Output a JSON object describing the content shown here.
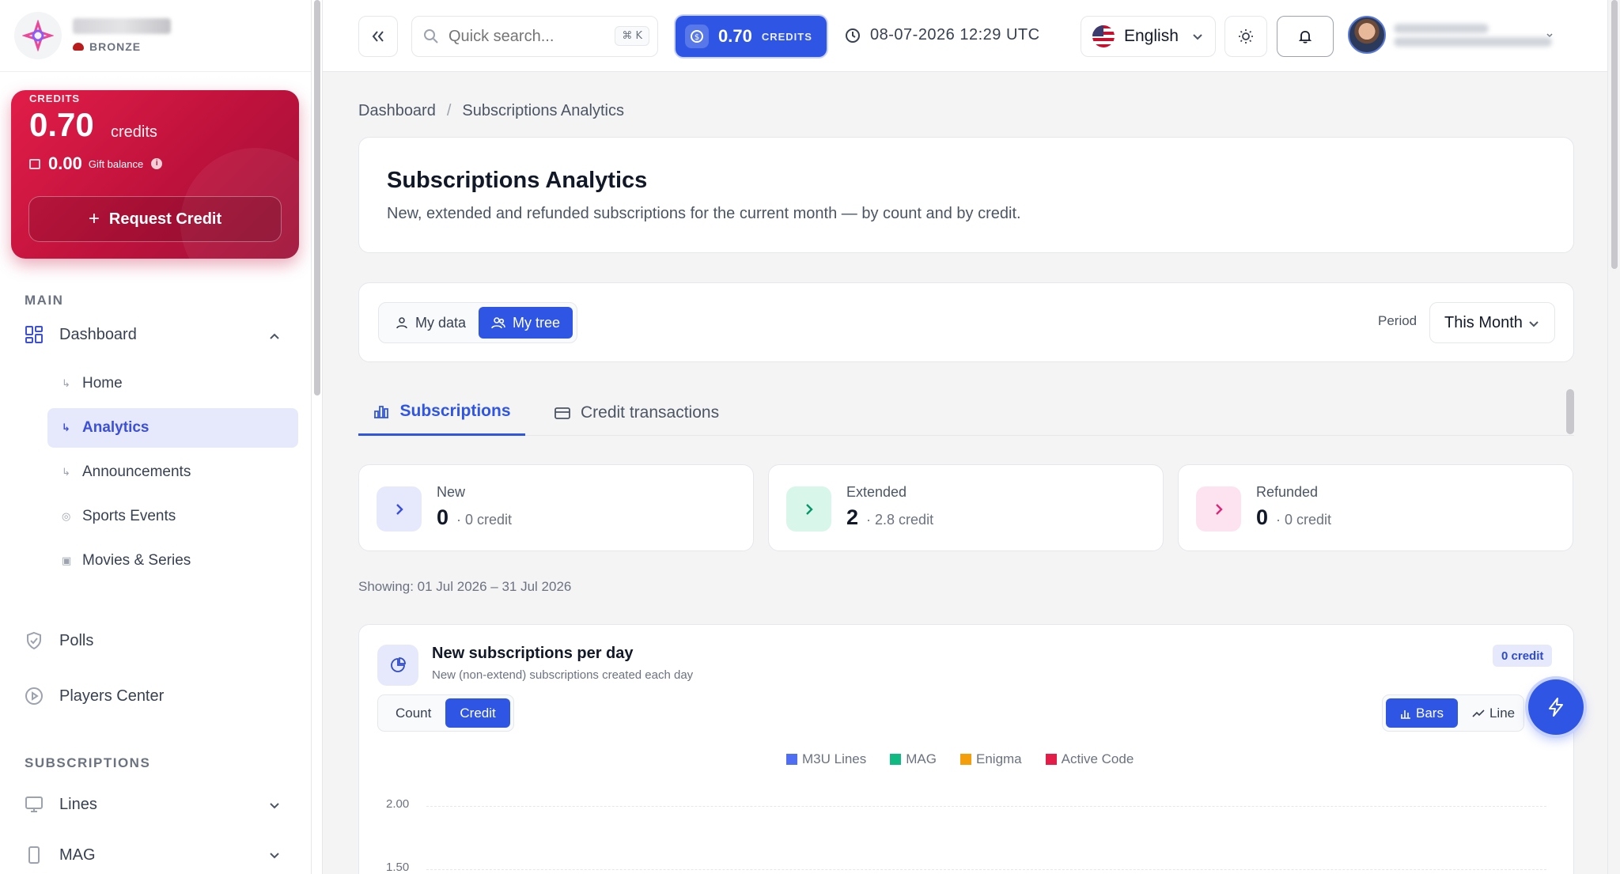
{
  "sidebar": {
    "tier": "BRONZE",
    "credits_card": {
      "label": "CREDITS",
      "amount": "0.70",
      "unit": "credits",
      "gift_amount": "0.00",
      "gift_label": "Gift balance",
      "request_button": "Request Credit"
    },
    "sections": {
      "main": "MAIN",
      "subscriptions": "SUBSCRIPTIONS"
    },
    "dashboard": {
      "label": "Dashboard",
      "children": [
        "Home",
        "Analytics",
        "Announcements",
        "Sports Events",
        "Movies & Series"
      ]
    },
    "polls": "Polls",
    "players_center": "Players Center",
    "lines": "Lines",
    "mag": "MAG"
  },
  "topbar": {
    "search_placeholder": "Quick search...",
    "shortcut": "⌘ K",
    "credits_value": "0.70",
    "credits_label": "CREDITS",
    "datetime": "08-07-2026 12:29 UTC",
    "language": "English"
  },
  "breadcrumb": [
    "Dashboard",
    "Subscriptions Analytics"
  ],
  "page": {
    "title": "Subscriptions Analytics",
    "subtitle": "New, extended and refunded subscriptions for the current month — by count and by credit."
  },
  "filters": {
    "my_data": "My data",
    "my_tree": "My tree",
    "period_label": "Period",
    "period_value": "This Month"
  },
  "tabs": {
    "subscriptions": "Subscriptions",
    "credit_transactions": "Credit transactions"
  },
  "stats": [
    {
      "label": "New",
      "count": "0",
      "credit": "· 0 credit",
      "color": "#3b4fd8"
    },
    {
      "label": "Extended",
      "count": "2",
      "credit": "· 2.8 credit",
      "color": "#059669"
    },
    {
      "label": "Refunded",
      "count": "0",
      "credit": "· 0 credit",
      "color": "#db2777"
    }
  ],
  "showing": "Showing: 01 Jul 2026 – 31 Jul 2026",
  "chart": {
    "title": "New subscriptions per day",
    "subtitle": "New (non-extend) subscriptions created each day",
    "badge": "0 credit",
    "mode_count": "Count",
    "mode_credit": "Credit",
    "view_bars": "Bars",
    "view_line": "Line"
  },
  "chart_data": {
    "type": "bar",
    "series": [
      {
        "name": "M3U Lines",
        "color": "#4f6ef2",
        "values": []
      },
      {
        "name": "MAG",
        "color": "#10b981",
        "values": []
      },
      {
        "name": "Enigma",
        "color": "#f59e0b",
        "values": []
      },
      {
        "name": "Active Code",
        "color": "#e11d48",
        "values": []
      }
    ],
    "y_ticks": [
      "2.00",
      "1.50"
    ]
  }
}
